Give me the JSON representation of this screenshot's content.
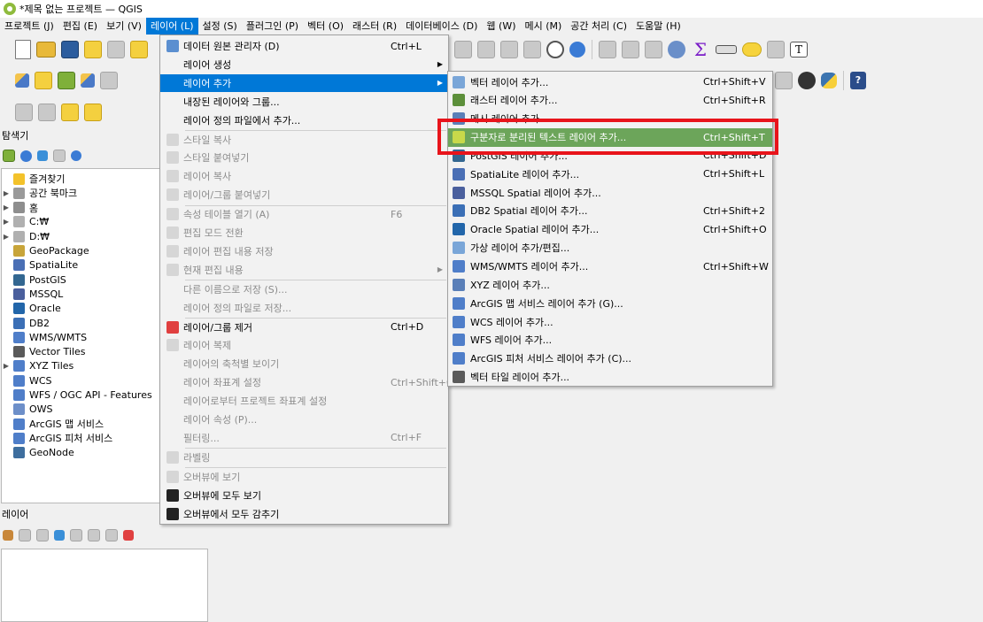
{
  "window": {
    "title": "*제목 없는 프로젝트 — QGIS"
  },
  "menubar": [
    {
      "label": "프로젝트 (J)",
      "active": false
    },
    {
      "label": "편집 (E)",
      "active": false
    },
    {
      "label": "보기 (V)",
      "active": false
    },
    {
      "label": "레이어 (L)",
      "active": true
    },
    {
      "label": "설정 (S)",
      "active": false
    },
    {
      "label": "플러그인 (P)",
      "active": false
    },
    {
      "label": "벡터 (O)",
      "active": false
    },
    {
      "label": "래스터 (R)",
      "active": false
    },
    {
      "label": "데이터베이스 (D)",
      "active": false
    },
    {
      "label": "웹 (W)",
      "active": false
    },
    {
      "label": "메시 (M)",
      "active": false
    },
    {
      "label": "공간 처리 (C)",
      "active": false
    },
    {
      "label": "도움말 (H)",
      "active": false
    }
  ],
  "browser": {
    "title": "탐색기",
    "items": [
      {
        "label": "즐겨찾기",
        "arrow": false,
        "color": "#f3c22b"
      },
      {
        "label": "공간 북마크",
        "arrow": true,
        "color": "#9a9a9a"
      },
      {
        "label": "홈",
        "arrow": true,
        "color": "#8e8e8e"
      },
      {
        "label": "C:₩",
        "arrow": true,
        "color": "#b0b0b0"
      },
      {
        "label": "D:₩",
        "arrow": true,
        "color": "#b0b0b0"
      },
      {
        "label": "GeoPackage",
        "arrow": false,
        "color": "#c8a53a"
      },
      {
        "label": "SpatiaLite",
        "arrow": false,
        "color": "#4a6fb5"
      },
      {
        "label": "PostGIS",
        "arrow": false,
        "color": "#336791"
      },
      {
        "label": "MSSQL",
        "arrow": false,
        "color": "#4a5f9d"
      },
      {
        "label": "Oracle",
        "arrow": false,
        "color": "#2266aa"
      },
      {
        "label": "DB2",
        "arrow": false,
        "color": "#3b6fb6"
      },
      {
        "label": "WMS/WMTS",
        "arrow": false,
        "color": "#4f7ec9"
      },
      {
        "label": "Vector Tiles",
        "arrow": false,
        "color": "#5a5a5a"
      },
      {
        "label": "XYZ Tiles",
        "arrow": true,
        "color": "#4f7ec9"
      },
      {
        "label": "WCS",
        "arrow": false,
        "color": "#4f7ec9"
      },
      {
        "label": "WFS / OGC API - Features",
        "arrow": false,
        "color": "#4f7ec9"
      },
      {
        "label": "OWS",
        "arrow": false,
        "color": "#6d8fc9"
      },
      {
        "label": "ArcGIS 맵 서비스",
        "arrow": false,
        "color": "#4f7ec9"
      },
      {
        "label": "ArcGIS 피처 서비스",
        "arrow": false,
        "color": "#4f7ec9"
      },
      {
        "label": "GeoNode",
        "arrow": false,
        "color": "#3e6e9e"
      }
    ]
  },
  "layers_panel": {
    "title": "레이어"
  },
  "layer_menu": [
    {
      "label": "데이터 원본 관리자 (D)",
      "shortcut": "Ctrl+L",
      "disabled": false,
      "arrow": false,
      "highlight": false,
      "icon": "#5b8fd0"
    },
    {
      "label": "레이어 생성",
      "shortcut": "",
      "disabled": false,
      "arrow": true,
      "highlight": false,
      "icon": ""
    },
    {
      "label": "레이어 추가",
      "shortcut": "",
      "disabled": false,
      "arrow": true,
      "highlight": true,
      "icon": ""
    },
    {
      "label": "내장된 레이어와 그룹...",
      "shortcut": "",
      "disabled": false,
      "arrow": false,
      "highlight": false,
      "icon": ""
    },
    {
      "label": "레이어 정의 파일에서 추가...",
      "shortcut": "",
      "disabled": false,
      "arrow": false,
      "highlight": false,
      "icon": ""
    },
    {
      "label": "스타일 복사",
      "shortcut": "",
      "disabled": true,
      "arrow": false,
      "highlight": false,
      "icon": "#d6d6d6"
    },
    {
      "label": "스타일 붙여넣기",
      "shortcut": "",
      "disabled": true,
      "arrow": false,
      "highlight": false,
      "icon": "#d6d6d6"
    },
    {
      "label": "레이어 복사",
      "shortcut": "",
      "disabled": true,
      "arrow": false,
      "highlight": false,
      "icon": "#d6d6d6"
    },
    {
      "label": "레이어/그룹 붙여넣기",
      "shortcut": "",
      "disabled": true,
      "arrow": false,
      "highlight": false,
      "icon": "#d6d6d6"
    },
    {
      "label": "속성 테이블 열기 (A)",
      "shortcut": "F6",
      "disabled": true,
      "arrow": false,
      "highlight": false,
      "icon": "#d6d6d6"
    },
    {
      "label": "편집 모드 전환",
      "shortcut": "",
      "disabled": true,
      "arrow": false,
      "highlight": false,
      "icon": "#d6d6d6"
    },
    {
      "label": "레이어 편집 내용 저장",
      "shortcut": "",
      "disabled": true,
      "arrow": false,
      "highlight": false,
      "icon": "#d6d6d6"
    },
    {
      "label": "현재 편집 내용",
      "shortcut": "",
      "disabled": true,
      "arrow": true,
      "highlight": false,
      "icon": "#d6d6d6"
    },
    {
      "label": "다른 이름으로 저장 (S)...",
      "shortcut": "",
      "disabled": true,
      "arrow": false,
      "highlight": false,
      "icon": ""
    },
    {
      "label": "레이어 정의 파일로 저장...",
      "shortcut": "",
      "disabled": true,
      "arrow": false,
      "highlight": false,
      "icon": ""
    },
    {
      "label": "레이어/그룹 제거",
      "shortcut": "Ctrl+D",
      "disabled": false,
      "arrow": false,
      "highlight": false,
      "icon": "#e04040"
    },
    {
      "label": "레이어 복제",
      "shortcut": "",
      "disabled": true,
      "arrow": false,
      "highlight": false,
      "icon": "#d6d6d6"
    },
    {
      "label": "레이어의 축척별 보이기",
      "shortcut": "",
      "disabled": true,
      "arrow": false,
      "highlight": false,
      "icon": ""
    },
    {
      "label": "레이어 좌표계 설정",
      "shortcut": "Ctrl+Shift+C",
      "disabled": true,
      "arrow": false,
      "highlight": false,
      "icon": ""
    },
    {
      "label": "레이어로부터 프로젝트 좌표계 설정",
      "shortcut": "",
      "disabled": true,
      "arrow": false,
      "highlight": false,
      "icon": ""
    },
    {
      "label": "레이어 속성 (P)...",
      "shortcut": "",
      "disabled": true,
      "arrow": false,
      "highlight": false,
      "icon": ""
    },
    {
      "label": "필터링...",
      "shortcut": "Ctrl+F",
      "disabled": true,
      "arrow": false,
      "highlight": false,
      "icon": ""
    },
    {
      "label": "라벨링",
      "shortcut": "",
      "disabled": true,
      "arrow": false,
      "highlight": false,
      "icon": "#d6d6d6"
    },
    {
      "label": "오버뷰에 보기",
      "shortcut": "",
      "disabled": true,
      "arrow": false,
      "highlight": false,
      "icon": "#d6d6d6"
    },
    {
      "label": "오버뷰에 모두 보기",
      "shortcut": "",
      "disabled": false,
      "arrow": false,
      "highlight": false,
      "icon": "#222222"
    },
    {
      "label": "오버뷰에서 모두 감추기",
      "shortcut": "",
      "disabled": false,
      "arrow": false,
      "highlight": false,
      "icon": "#222222"
    }
  ],
  "add_layer_submenu": [
    {
      "label": "벡터 레이어 추가...",
      "shortcut": "Ctrl+Shift+V",
      "icon": "#7aa6d8",
      "highlight": false
    },
    {
      "label": "래스터 레이어 추가...",
      "shortcut": "Ctrl+Shift+R",
      "icon": "#5c8f3a",
      "highlight": false
    },
    {
      "label": "메시 레이어 추가...",
      "shortcut": "",
      "icon": "#5a7fb8",
      "highlight": false
    },
    {
      "label": "구분자로 분리된 텍스트 레이어 추가...",
      "shortcut": "Ctrl+Shift+T",
      "icon": "#c8d94a",
      "highlight": true
    },
    {
      "label": "PostGIS 레이어 추가...",
      "shortcut": "Ctrl+Shift+D",
      "icon": "#336791",
      "highlight": false
    },
    {
      "label": "SpatiaLite 레이어 추가...",
      "shortcut": "Ctrl+Shift+L",
      "icon": "#4a6fb5",
      "highlight": false
    },
    {
      "label": "MSSQL Spatial 레이어 추가...",
      "shortcut": "",
      "icon": "#4a5f9d",
      "highlight": false
    },
    {
      "label": "DB2 Spatial 레이어 추가...",
      "shortcut": "Ctrl+Shift+2",
      "icon": "#3b6fb6",
      "highlight": false
    },
    {
      "label": "Oracle Spatial 레이어 추가...",
      "shortcut": "Ctrl+Shift+O",
      "icon": "#2266aa",
      "highlight": false
    },
    {
      "label": "가상 레이어 추가/편집...",
      "shortcut": "",
      "icon": "#7aa6d8",
      "highlight": false
    },
    {
      "label": "WMS/WMTS 레이어 추가...",
      "shortcut": "Ctrl+Shift+W",
      "icon": "#4f7ec9",
      "highlight": false
    },
    {
      "label": "XYZ 레이어 추가...",
      "shortcut": "",
      "icon": "#5a7fb8",
      "highlight": false
    },
    {
      "label": "ArcGIS 맵 서비스 레이어 추가 (G)...",
      "shortcut": "",
      "icon": "#4f7ec9",
      "highlight": false
    },
    {
      "label": "WCS 레이어 추가...",
      "shortcut": "",
      "icon": "#4f7ec9",
      "highlight": false
    },
    {
      "label": "WFS 레이어 추가...",
      "shortcut": "",
      "icon": "#4f7ec9",
      "highlight": false
    },
    {
      "label": "ArcGIS 피처 서비스 레이어 추가 (C)...",
      "shortcut": "",
      "icon": "#4f7ec9",
      "highlight": false
    },
    {
      "label": "벡터 타일 레이어 추가...",
      "shortcut": "",
      "icon": "#5a5a5a",
      "highlight": false
    }
  ],
  "colors": {
    "accent": "#0078d7",
    "highlight_green": "#6ca55a",
    "annotation_red": "#e8141b"
  }
}
